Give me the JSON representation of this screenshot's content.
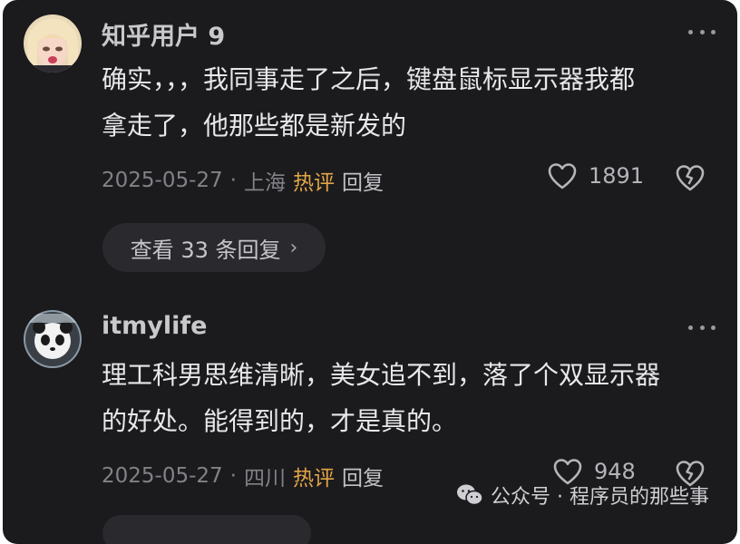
{
  "comments": [
    {
      "username": "知乎用户 9",
      "lines": [
        "确实，，，我同事走了之后，键盘鼠标显示器我都",
        "拿走了，他那些都是新发的"
      ],
      "date": "2025-05-27",
      "dot": "·",
      "location": "上海",
      "hot_label": "热评",
      "reply_label": "回复",
      "like_count": "1891",
      "view_replies": "查看 33 条回复"
    },
    {
      "username": "itmylife",
      "lines": [
        "理工科男思维清晰，美女追不到，落了个双显示器",
        "的好处。能得到的，才是真的。"
      ],
      "date": "2025-05-27",
      "dot": "·",
      "location": "四川",
      "hot_label": "热评",
      "reply_label": "回复",
      "like_count": "948"
    }
  ],
  "watermark": {
    "text": "公众号 · 程序员的那些事",
    "icon": "wechat-icon"
  },
  "icons": {
    "like": "heart-icon",
    "dislike": "broken-heart-icon",
    "more": "more-dots-icon",
    "chevron": "chevron-right-icon"
  },
  "colors": {
    "background": "#1b1b1e",
    "hot": "#e3a545",
    "pill": "#2a2a2e"
  }
}
